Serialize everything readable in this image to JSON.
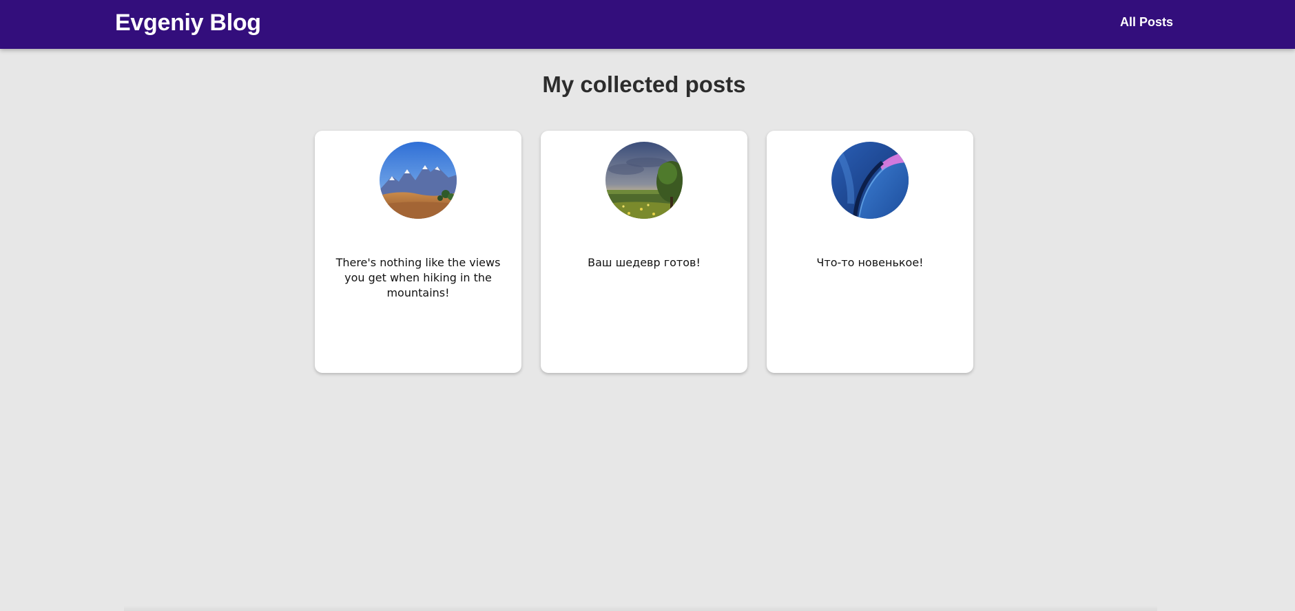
{
  "header": {
    "brand": "Evgeniy Blog",
    "nav": [
      {
        "label": "All Posts"
      }
    ],
    "background_color": "#330e7c"
  },
  "main": {
    "title": "My collected posts",
    "posts": [
      {
        "image": "mountain-landscape",
        "text": "There's nothing like the views you get when hiking in the mountains!"
      },
      {
        "image": "field-tree-sunset",
        "text": "Ваш шедевр готов!"
      },
      {
        "image": "blue-abstract-wave",
        "text": "Что-то новенькое!"
      }
    ]
  }
}
